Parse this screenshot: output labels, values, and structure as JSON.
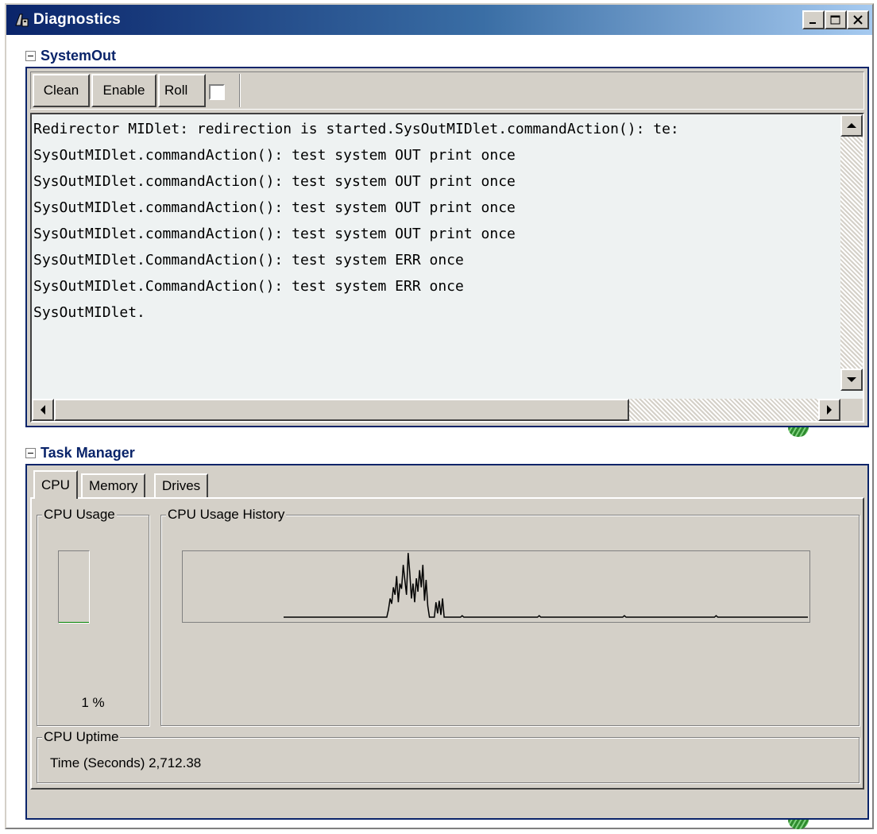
{
  "window": {
    "title": "Diagnostics"
  },
  "systemout": {
    "title": "SystemOut",
    "toolbar": {
      "clean": "Clean",
      "enable": "Enable",
      "roll": "Roll",
      "roll_checked": false
    },
    "lines": [
      "Redirector MIDlet: redirection is started.SysOutMIDlet.commandAction(): te:",
      "SysOutMIDlet.commandAction(): test system OUT print once",
      "SysOutMIDlet.commandAction(): test system OUT print once",
      "SysOutMIDlet.commandAction(): test system OUT print once",
      "SysOutMIDlet.commandAction(): test system OUT print once",
      "SysOutMIDlet.CommandAction(): test system ERR once",
      "SysOutMIDlet.CommandAction(): test system ERR once",
      "SysOutMIDlet."
    ]
  },
  "taskmanager": {
    "title": "Task Manager",
    "tabs": [
      {
        "label": "CPU",
        "active": true
      },
      {
        "label": "Memory",
        "active": false
      },
      {
        "label": "Drives",
        "active": false
      }
    ],
    "cpu_usage": {
      "label": "CPU Usage",
      "value_text": "1 %",
      "percent": 1
    },
    "cpu_history": {
      "label": "CPU Usage History",
      "samples": [
        0,
        0,
        0,
        0,
        0,
        0,
        0,
        0,
        0,
        0,
        0,
        0,
        0,
        0,
        0,
        0,
        0,
        0,
        0,
        0,
        0,
        0,
        0,
        0,
        0,
        0,
        0,
        0,
        0,
        0,
        0,
        0,
        0,
        0,
        0,
        0,
        0,
        0,
        0,
        0,
        0,
        0,
        0,
        0,
        0,
        0,
        0,
        0,
        0,
        0,
        0,
        0,
        0,
        0,
        0,
        0,
        0,
        0,
        0,
        0,
        0,
        0,
        0,
        0,
        10,
        25,
        18,
        40,
        30,
        55,
        20,
        45,
        38,
        70,
        50,
        30,
        86,
        60,
        25,
        45,
        20,
        52,
        34,
        63,
        40,
        70,
        22,
        50,
        15,
        0,
        0,
        0,
        0,
        20,
        5,
        22,
        3,
        25,
        0,
        0,
        0,
        0,
        0,
        0,
        0,
        0,
        0,
        0,
        0,
        2,
        0,
        0,
        0,
        0,
        0,
        0,
        0,
        0,
        0,
        0,
        0,
        0,
        0,
        0,
        0,
        0,
        0,
        0,
        0,
        0,
        0,
        0,
        0,
        0,
        0,
        0,
        0,
        0,
        0,
        0,
        0,
        0,
        0,
        0,
        0,
        0,
        0,
        0,
        0,
        0,
        0,
        0,
        0,
        0,
        0,
        0,
        2,
        0,
        0,
        0,
        0,
        0,
        0,
        0,
        0,
        0,
        0,
        0,
        0,
        0,
        0,
        0,
        0,
        0,
        0,
        0,
        0,
        0,
        0,
        0,
        0,
        0,
        0,
        0,
        0,
        0,
        0,
        0,
        0,
        0,
        0,
        0,
        0,
        0,
        0,
        0,
        0,
        0,
        0,
        0,
        0,
        0,
        0,
        0,
        0,
        0,
        0,
        0,
        2,
        0,
        0,
        0,
        0,
        0,
        0,
        0,
        0,
        0,
        0,
        0,
        0,
        0,
        0,
        0,
        0,
        0,
        0,
        0,
        0,
        0,
        0,
        0,
        0,
        0,
        0,
        0,
        0,
        0,
        0,
        0,
        0,
        0,
        0,
        0,
        0,
        0,
        0,
        0,
        0,
        0,
        0,
        0,
        0,
        0,
        0,
        0,
        0,
        0,
        0,
        0,
        0,
        0,
        0,
        0,
        2,
        0,
        0,
        0,
        0,
        0,
        0,
        0,
        0,
        0,
        0,
        0,
        0,
        0,
        0,
        0,
        0,
        0,
        0,
        0,
        0,
        0,
        0,
        0,
        0,
        0,
        0,
        0,
        0,
        0,
        0,
        0,
        0,
        0,
        0,
        0,
        0,
        0,
        0,
        0,
        0,
        0,
        0,
        0,
        0,
        0,
        0,
        0,
        0,
        0,
        0,
        0,
        0,
        0,
        0,
        0,
        0
      ]
    },
    "cpu_uptime": {
      "label": "CPU Uptime",
      "text": "Time (Seconds) 2,712.38"
    }
  },
  "colors": {
    "section_title": "#0a246a",
    "panel_border": "#0a246a",
    "console_bg": "#eef2f2",
    "chrome": "#d4d0c8"
  }
}
